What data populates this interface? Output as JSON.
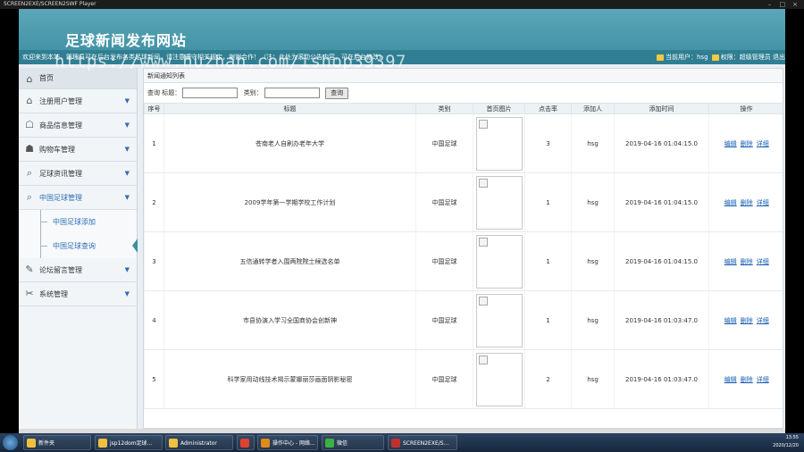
{
  "window": {
    "title": "SCREEN2EXE/SCREEN2SWF Player",
    "controls": [
      "–",
      "□",
      "×"
    ]
  },
  "header": {
    "site_title": "足球新闻发布网站",
    "marquee": "欢迎来到本站，管理员可在后台发布各类足球新闻，请注意遵守相关规定，谢谢合作！（注：此处为滚动公告内容，可在后台修改）",
    "current_user_label": "当前用户：hsg",
    "role_label": "权限：超级管理员",
    "logout_label": "退出",
    "watermark": "https://www.huzhan.com/ishop39397"
  },
  "sidebar": {
    "items": [
      {
        "label": "首页",
        "icon": "home-icon",
        "glyph": "⌂"
      },
      {
        "label": "注册用户管理",
        "icon": "house-icon",
        "glyph": "⌂"
      },
      {
        "label": "商品信息管理",
        "icon": "chat-icon",
        "glyph": "☖"
      },
      {
        "label": "购物车管理",
        "icon": "user-icon",
        "glyph": "☗"
      },
      {
        "label": "足球资讯管理",
        "icon": "search-icon",
        "glyph": "⌕"
      },
      {
        "label": "中国足球管理",
        "icon": "search-icon",
        "glyph": "⌕"
      },
      {
        "label": "论坛留言管理",
        "icon": "edit-icon",
        "glyph": "✎"
      },
      {
        "label": "系统管理",
        "icon": "tools-icon",
        "glyph": "✂"
      }
    ],
    "sub_items": [
      "中国足球添加",
      "中国足球查询"
    ]
  },
  "main": {
    "panel_title": "新闻通知列表",
    "search": {
      "label": "查询 标题：",
      "category_label": "类别：",
      "title_value": "",
      "category_value": "",
      "button": "查询"
    },
    "columns": [
      "序号",
      "标题",
      "类别",
      "首页图片",
      "点击率",
      "添加人",
      "添加时间",
      "操作"
    ],
    "rows": [
      {
        "no": "1",
        "title": "苍南老人自刷办老年大学",
        "category": "中国足球",
        "clicks": "3",
        "adder": "hsg",
        "time": "2019-04-16 01:04:15.0"
      },
      {
        "no": "2",
        "title": "2009学年第一学期学校工作计划",
        "category": "中国足球",
        "clicks": "1",
        "adder": "hsg",
        "time": "2019-04-16 01:04:15.0"
      },
      {
        "no": "3",
        "title": "五信通转学者入围两院院士候选名单",
        "category": "中国足球",
        "clicks": "1",
        "adder": "hsg",
        "time": "2019-04-16 01:04:15.0"
      },
      {
        "no": "4",
        "title": "市县协演入学习全国商协会创新神",
        "category": "中国足球",
        "clicks": "1",
        "adder": "hsg",
        "time": "2019-04-16 01:03:47.0"
      },
      {
        "no": "5",
        "title": "科学家用动线技术揭示蒙娜丽莎画面阴影秘密",
        "category": "中国足球",
        "clicks": "2",
        "adder": "hsg",
        "time": "2019-04-16 01:03:47.0"
      }
    ],
    "ops": [
      "编辑",
      "删除",
      "详细"
    ]
  },
  "taskbar": {
    "tasks": [
      {
        "label": "新件夹",
        "color": "#f0c040"
      },
      {
        "label": "jsp12dom足球...",
        "color": "#f0c040"
      },
      {
        "label": "Administrator",
        "color": "#f0c040"
      },
      {
        "label": "",
        "color": "#e04030"
      },
      {
        "label": "操作中心 - 网络...",
        "color": "#e08a1a"
      },
      {
        "label": "微信",
        "color": "#3cb043"
      },
      {
        "label": "SCREEN2EXE/S...",
        "color": "#c03030"
      }
    ],
    "clock": "13:55",
    "date": "2020/12/20"
  }
}
